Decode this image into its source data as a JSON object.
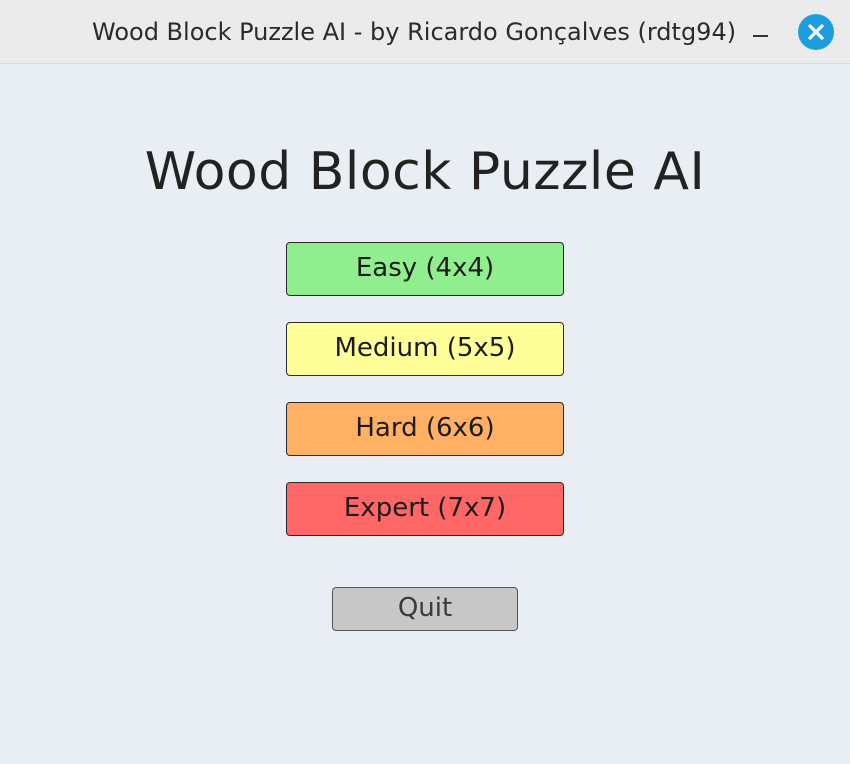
{
  "window": {
    "title": "Wood Block Puzzle AI - by Ricardo Gonçalves (rdtg94)",
    "controls": {
      "minimize_icon": "minimize-icon",
      "close_icon": "close-icon",
      "close_color": "#1e9ee0"
    }
  },
  "main": {
    "heading": "Wood Block Puzzle AI",
    "difficulty_buttons": [
      {
        "label": "Easy (4x4)",
        "color": "#90ee8f"
      },
      {
        "label": "Medium (5x5)",
        "color": "#ffff99"
      },
      {
        "label": "Hard (6x6)",
        "color": "#ffb063"
      },
      {
        "label": "Expert (7x7)",
        "color": "#ff6666"
      }
    ],
    "quit_label": "Quit",
    "quit_color": "#c7c7c7"
  }
}
